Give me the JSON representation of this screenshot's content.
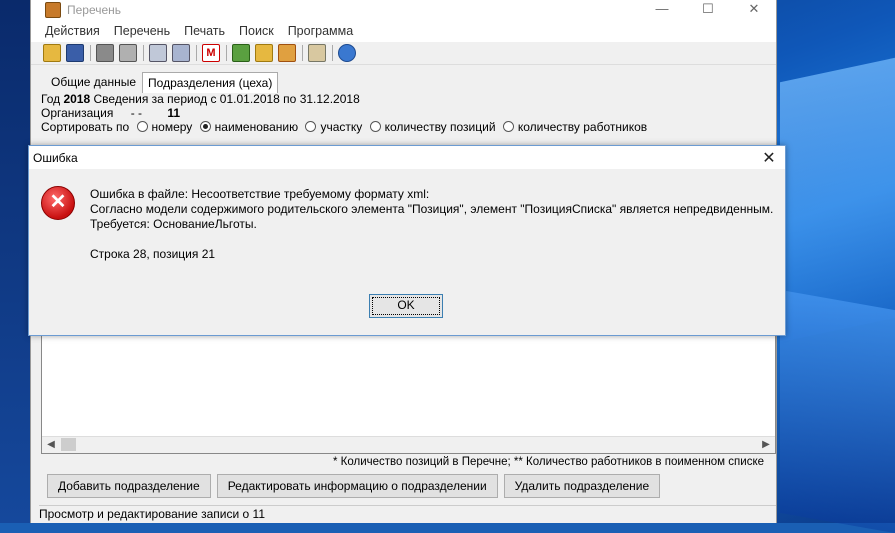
{
  "window": {
    "title": "Перечень",
    "minimize": "—",
    "maximize": "☐",
    "close": "✕"
  },
  "menu": [
    "Действия",
    "Перечень",
    "Печать",
    "Поиск",
    "Программа"
  ],
  "tabs": [
    {
      "label": "Общие данные",
      "active": false
    },
    {
      "label": "Подразделения (цеха)",
      "active": true
    }
  ],
  "panel": {
    "year_label": "Год",
    "year": "2018",
    "period": "Сведения за период с 01.01.2018 по 31.12.2018",
    "org_label": "Организация",
    "org_dash": "-  -",
    "org_value": "11",
    "sort_label": "Сортировать по",
    "sort_options": [
      {
        "label": "номеру",
        "selected": false
      },
      {
        "label": "наименованию",
        "selected": true
      },
      {
        "label": "участку",
        "selected": false
      },
      {
        "label": "количеству позиций",
        "selected": false
      },
      {
        "label": "количеству работников",
        "selected": false
      }
    ]
  },
  "footnote": "* Количество позиций в Перечне; ** Количество работников в поименном списке",
  "buttons": {
    "add": "Добавить подразделение",
    "edit": "Редактировать информацию о подразделении",
    "delete": "Удалить подразделение"
  },
  "status": "Просмотр и редактирование записи о 11",
  "dialog": {
    "title": "Ошибка",
    "close": "✕",
    "icon": "error-icon",
    "line1": "Ошибка в файле: Несоответствие требуемому формату xml:",
    "line2": "Согласно модели содержимого родительского элемента \"Позиция\", элемент \"ПозицияСписка\" является непредвиденным.",
    "line3": "Требуется: ОснованиеЛьготы.",
    "line4": "Строка 28, позиция 21",
    "ok": "OK"
  },
  "colors": {
    "dialog_border": "#6b9bd2",
    "error_red": "#c81010"
  }
}
